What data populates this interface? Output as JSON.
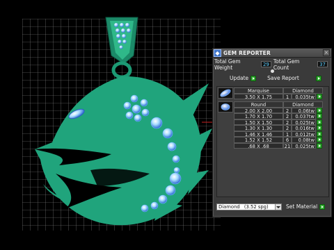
{
  "viewport": {
    "background": "#000000",
    "grid_color": "#9a9a9a",
    "model_color": "#1fa07a",
    "gem_color": "#9fdcff"
  },
  "panel": {
    "title": "GEM REPORTER",
    "total_weight_label": "Total Gem Weight",
    "total_weight_value": "29",
    "total_count_label": "Total Gem Count",
    "total_count_value": "37",
    "update_label": "Update",
    "save_label": "Save Report",
    "groups": [
      {
        "icon": "marquise-gem-icon",
        "header": {
          "shape": "Marquise",
          "material": "Diamond"
        },
        "rows": [
          {
            "size": "3.50 X 1.75",
            "qty": "1",
            "weight": "0.035tw"
          }
        ]
      },
      {
        "icon": "round-gem-icon",
        "header": {
          "shape": "Round",
          "material": "Diamond"
        },
        "rows": [
          {
            "size": "2.00 X 2.00",
            "qty": "2",
            "weight": "0.06tw"
          },
          {
            "size": "1.70 X 1.70",
            "qty": "2",
            "weight": "0.037tw"
          },
          {
            "size": "1.50 X 1.50",
            "qty": "2",
            "weight": "0.025tw"
          },
          {
            "size": "1.30 X 1.30",
            "qty": "2",
            "weight": "0.016tw"
          },
          {
            "size": "1.46 X 1.46",
            "qty": "1",
            "weight": "0.012tw"
          },
          {
            "size": "1.52 X 1.52",
            "qty": "6",
            "weight": "0.08tw"
          },
          {
            "size": ".68 X .68",
            "qty": "21",
            "weight": "0.025tw"
          }
        ]
      }
    ],
    "material_select": "Diamond",
    "material_spg": "(3.52 spg)",
    "set_material_label": "Set Material"
  }
}
